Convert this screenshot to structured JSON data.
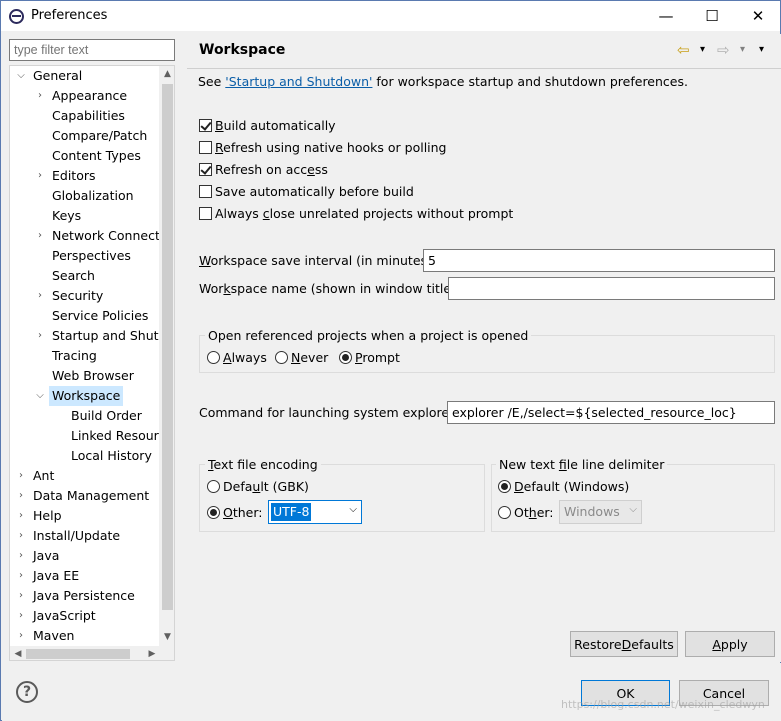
{
  "window": {
    "title": "Preferences",
    "minimize_glyph": "—",
    "maximize_glyph": "☐",
    "close_glyph": "✕"
  },
  "filter": {
    "placeholder": "type filter text"
  },
  "tree": {
    "items": [
      {
        "label": "General",
        "arrow": "⌵"
      },
      {
        "label": "Appearance",
        "arrow": "›"
      },
      {
        "label": "Capabilities",
        "arrow": ""
      },
      {
        "label": "Compare/Patch",
        "arrow": ""
      },
      {
        "label": "Content Types",
        "arrow": ""
      },
      {
        "label": "Editors",
        "arrow": "›"
      },
      {
        "label": "Globalization",
        "arrow": ""
      },
      {
        "label": "Keys",
        "arrow": ""
      },
      {
        "label": "Network Connecti",
        "arrow": "›"
      },
      {
        "label": "Perspectives",
        "arrow": ""
      },
      {
        "label": "Search",
        "arrow": ""
      },
      {
        "label": "Security",
        "arrow": "›"
      },
      {
        "label": "Service Policies",
        "arrow": ""
      },
      {
        "label": "Startup and Shutd",
        "arrow": "›"
      },
      {
        "label": "Tracing",
        "arrow": ""
      },
      {
        "label": "Web Browser",
        "arrow": ""
      },
      {
        "label": "Workspace",
        "arrow": "⌵"
      },
      {
        "label": "Build Order",
        "arrow": ""
      },
      {
        "label": "Linked Resourc",
        "arrow": ""
      },
      {
        "label": "Local History",
        "arrow": ""
      },
      {
        "label": "Ant",
        "arrow": "›"
      },
      {
        "label": "Data Management",
        "arrow": "›"
      },
      {
        "label": "Help",
        "arrow": "›"
      },
      {
        "label": "Install/Update",
        "arrow": "›"
      },
      {
        "label": "Java",
        "arrow": "›"
      },
      {
        "label": "Java EE",
        "arrow": "›"
      },
      {
        "label": "Java Persistence",
        "arrow": "›"
      },
      {
        "label": "JavaScript",
        "arrow": "›"
      },
      {
        "label": "Maven",
        "arrow": "›"
      }
    ],
    "scroll_up": "▲",
    "scroll_down": "▼",
    "scroll_left": "◀",
    "scroll_right": "▶"
  },
  "page": {
    "title": "Workspace",
    "nav_back": "⇦",
    "nav_forward": "⇨",
    "nav_menu": "▾",
    "intro_prefix": "See ",
    "intro_link": "'Startup and Shutdown'",
    "intro_suffix": " for workspace startup and shutdown preferences.",
    "checkboxes": [
      {
        "pre": "",
        "u": "B",
        "post": "uild automatically",
        "checked": true
      },
      {
        "pre": "",
        "u": "R",
        "post": "efresh using native hooks or polling",
        "checked": false
      },
      {
        "pre": "Refresh on acc",
        "u": "e",
        "post": "ss",
        "checked": true
      },
      {
        "pre": "Save automatically before build",
        "u": "",
        "post": "",
        "checked": false
      },
      {
        "pre": "Always ",
        "u": "c",
        "post": "lose unrelated projects without prompt",
        "checked": false
      }
    ],
    "save_interval": {
      "u": "W",
      "label": "orkspace save interval (in minutes):",
      "value": "5"
    },
    "workspace_name": {
      "pre": "Wor",
      "u": "k",
      "label": "space name (shown in window title):",
      "value": ""
    },
    "open_ref": {
      "title": "Open referenced projects when a project is opened",
      "options": [
        {
          "pre": "",
          "u": "A",
          "post": "lways",
          "selected": false
        },
        {
          "pre": "",
          "u": "N",
          "post": "ever",
          "selected": false
        },
        {
          "pre": "",
          "u": "P",
          "post": "rompt",
          "selected": true
        }
      ]
    },
    "explorer_cmd": {
      "label": "Command for launching system explorer:",
      "value": "explorer /E,/select=${selected_resource_loc}"
    },
    "encoding": {
      "title_pre": "",
      "title_u": "T",
      "title_post": "ext file encoding",
      "default_pre": "Defa",
      "default_u": "u",
      "default_post": "lt (GBK)",
      "other_pre": "",
      "other_u": "O",
      "other_post": "ther:",
      "selected": "other",
      "other_value": "UTF-8"
    },
    "delimiter": {
      "title_pre": "New text ",
      "title_u": "f",
      "title_post": "ile line delimiter",
      "default_pre": "",
      "default_u": "D",
      "default_post": "efault (Windows)",
      "other_pre": "Ot",
      "other_u": "h",
      "other_post": "er:",
      "selected": "default",
      "other_value": "Windows"
    },
    "restore_defaults": {
      "pre": "Restore ",
      "u": "D",
      "post": "efaults"
    },
    "apply": {
      "pre": "",
      "u": "A",
      "post": "pply"
    }
  },
  "dialog": {
    "help_glyph": "?",
    "ok": "OK",
    "cancel": "Cancel"
  },
  "watermark": "https://blog.csdn.net/weixin_cledwyn"
}
